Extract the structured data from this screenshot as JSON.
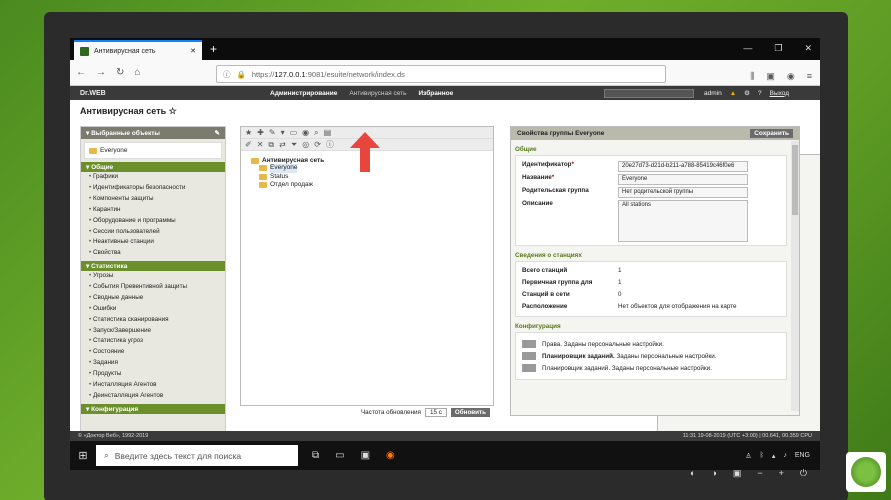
{
  "browser": {
    "tab_title": "Антивирусная сеть",
    "url_prefix": "https://",
    "url_host": "127.0.0.1",
    "url_rest": ":9081/esuite/network/index.ds",
    "url_menu": "•••"
  },
  "app": {
    "logo": "Dr.WEB",
    "menu": [
      "Администрирование",
      "Антивирусная сеть",
      "Избранное"
    ],
    "user": "admin",
    "logout": "Выход",
    "page_title": "Антивирусная сеть ☆"
  },
  "sidebar": {
    "header": "▾ Выбранные объекты",
    "selected": "Everyone",
    "group_general": "▾ Общие",
    "general_items": [
      "Графики",
      "Идентификаторы безопасности",
      "Компоненты защиты",
      "Карантин",
      "Оборудование и программы",
      "Сессии пользователей",
      "Неактивные станции",
      "Свойства"
    ],
    "group_stats": "▾ Статистика",
    "stats_items": [
      "Угрозы",
      "События Превентивной защиты",
      "Сводные данные",
      "Ошибки",
      "Статистика сканирования",
      "Запуск/Завершение",
      "Статистика угроз",
      "Состояние",
      "Задания",
      "Продукты",
      "Инсталляция Агентов",
      "Деинсталляция Агентов"
    ],
    "group_config": "▾ Конфигурация"
  },
  "tree": {
    "root": "Антивирусная сеть",
    "nodes": [
      "Everyone",
      "Status",
      "Отдел продаж"
    ]
  },
  "center_footer": {
    "label": "Частота обновления",
    "value": "15 с",
    "button": "Обновить"
  },
  "props": {
    "title": "Свойства группы Everyone",
    "save": "Сохранить",
    "sec_general": "Общие",
    "id_label": "Идентификатор",
    "id_value": "20e27d73-d21d-b211-a788-85419c46f0e6",
    "name_label": "Название",
    "name_value": "Everyone",
    "parent_label": "Родительская группа",
    "parent_value": "Нет родительской группы",
    "desc_label": "Описание",
    "desc_value": "All stations",
    "sec_stations": "Сведения о станциях",
    "total_label": "Всего станций",
    "total_value": "1",
    "primary_label": "Первичная группа для",
    "primary_value": "1",
    "online_label": "Станций в сети",
    "online_value": "0",
    "location_label": "Расположение",
    "location_value": "Нет объектов для отображения на карте",
    "sec_config": "Конфигурация",
    "cfg1": "Права. Заданы персональные настройки.",
    "cfg2_b": "Планировщик заданий.",
    "cfg2": " Заданы персональные настройки.",
    "cfg3": "Планировщик заданий. Заданы персональные настройки."
  },
  "footer": {
    "left": "© «Доктор Веб», 1992-2019",
    "right": "11:31 19-08-2019 (UTC +3:00) | 00.641, 00.359 CPU"
  },
  "taskbar": {
    "search_placeholder": "Введите здесь текст для поиска",
    "lang": "ENG"
  },
  "colors": {
    "accent": "#6b8f2a",
    "header": "#3a3a3a",
    "arrow": "#e8453c"
  }
}
